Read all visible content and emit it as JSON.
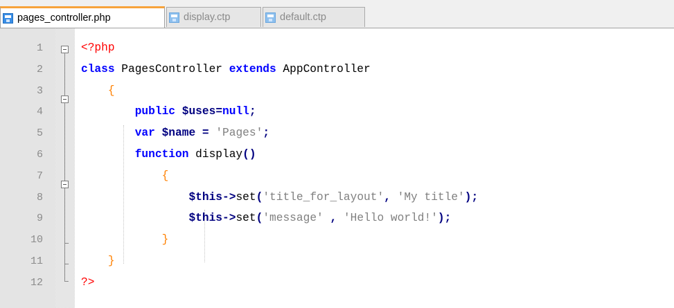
{
  "tabs": [
    {
      "label": "pages_controller.php",
      "active": true
    },
    {
      "label": "display.ctp",
      "active": false
    },
    {
      "label": "default.ctp",
      "active": false
    }
  ],
  "editor": {
    "line_numbers": [
      "1",
      "2",
      "3",
      "4",
      "5",
      "6",
      "7",
      "8",
      "9",
      "10",
      "11",
      "12"
    ],
    "lines": [
      {
        "tokens": [
          {
            "t": "<?php",
            "c": "phptag"
          }
        ]
      },
      {
        "tokens": [
          {
            "t": "class",
            "c": "kw"
          },
          {
            "t": " PagesController ",
            "c": "pl"
          },
          {
            "t": "extends",
            "c": "kw"
          },
          {
            "t": " AppController",
            "c": "pl"
          }
        ]
      },
      {
        "tokens": [
          {
            "t": "    ",
            "c": "pl"
          },
          {
            "t": "{",
            "c": "brace"
          }
        ]
      },
      {
        "tokens": [
          {
            "t": "        ",
            "c": "pl"
          },
          {
            "t": "public",
            "c": "kw"
          },
          {
            "t": " $uses",
            "c": "var"
          },
          {
            "t": "=",
            "c": "op"
          },
          {
            "t": "null",
            "c": "kw"
          },
          {
            "t": ";",
            "c": "op"
          }
        ]
      },
      {
        "tokens": [
          {
            "t": "        ",
            "c": "pl"
          },
          {
            "t": "var",
            "c": "kw"
          },
          {
            "t": " $name",
            "c": "var"
          },
          {
            "t": " = ",
            "c": "op"
          },
          {
            "t": "'Pages'",
            "c": "str"
          },
          {
            "t": ";",
            "c": "op"
          }
        ]
      },
      {
        "tokens": [
          {
            "t": "        ",
            "c": "pl"
          },
          {
            "t": "function",
            "c": "kw"
          },
          {
            "t": " display",
            "c": "pl"
          },
          {
            "t": "()",
            "c": "op"
          }
        ]
      },
      {
        "tokens": [
          {
            "t": "            ",
            "c": "pl"
          },
          {
            "t": "{",
            "c": "brace"
          }
        ]
      },
      {
        "tokens": [
          {
            "t": "                ",
            "c": "pl"
          },
          {
            "t": "$this",
            "c": "var"
          },
          {
            "t": "->",
            "c": "op"
          },
          {
            "t": "set",
            "c": "pl"
          },
          {
            "t": "(",
            "c": "op"
          },
          {
            "t": "'title_for_layout'",
            "c": "str"
          },
          {
            "t": ", ",
            "c": "op"
          },
          {
            "t": "'My title'",
            "c": "str"
          },
          {
            "t": ");",
            "c": "op"
          }
        ]
      },
      {
        "tokens": [
          {
            "t": "                ",
            "c": "pl"
          },
          {
            "t": "$this",
            "c": "var"
          },
          {
            "t": "->",
            "c": "op"
          },
          {
            "t": "set",
            "c": "pl"
          },
          {
            "t": "(",
            "c": "op"
          },
          {
            "t": "'message'",
            "c": "str"
          },
          {
            "t": " , ",
            "c": "op"
          },
          {
            "t": "'Hello world!'",
            "c": "str"
          },
          {
            "t": ");",
            "c": "op"
          }
        ]
      },
      {
        "tokens": [
          {
            "t": "            ",
            "c": "pl"
          },
          {
            "t": "}",
            "c": "brace"
          }
        ]
      },
      {
        "tokens": [
          {
            "t": "    ",
            "c": "pl"
          },
          {
            "t": "}",
            "c": "brace"
          }
        ]
      },
      {
        "tokens": [
          {
            "t": "?>",
            "c": "phptag"
          }
        ]
      }
    ]
  },
  "colors": {
    "keyword": "#0000ff",
    "variable": "#000080",
    "string": "#808080",
    "php_tag": "#ff0000",
    "brace": "#ff8000",
    "active_tab_accent": "#f7a33b"
  },
  "icons": {
    "tab_icon": "floppy-save-icon",
    "fold_icon": "fold-minus-icon"
  }
}
